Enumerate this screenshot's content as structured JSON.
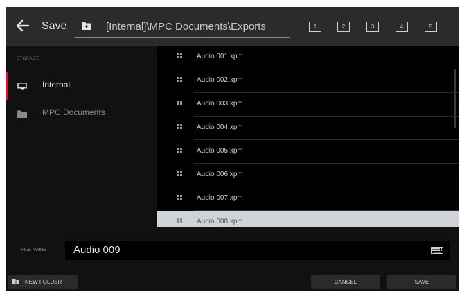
{
  "header": {
    "back_icon": "arrow-left-icon",
    "title": "Save",
    "folder_up_icon": "folder-up-icon",
    "path": "[Internal]\\MPC Documents\\Exports",
    "quick_slots": [
      "1",
      "2",
      "3",
      "4",
      "5"
    ]
  },
  "sidebar": {
    "section_label": "STORAGE",
    "items": [
      {
        "label": "Internal",
        "icon": "monitor-icon",
        "active": true
      },
      {
        "label": "MPC Documents",
        "icon": "folder-icon",
        "active": false
      }
    ]
  },
  "files": [
    {
      "name": "Audio 001.xpm",
      "icon": "grid-icon"
    },
    {
      "name": "Audio 002.xpm",
      "icon": "grid-icon"
    },
    {
      "name": "Audio 003.xpm",
      "icon": "grid-icon"
    },
    {
      "name": "Audio 004.xpm",
      "icon": "grid-icon"
    },
    {
      "name": "Audio 005.xpm",
      "icon": "grid-icon"
    },
    {
      "name": "Audio 006.xpm",
      "icon": "grid-icon"
    },
    {
      "name": "Audio 007.xpm",
      "icon": "grid-icon"
    },
    {
      "name": "Audio 008.xpm",
      "icon": "grid-icon",
      "selected": true
    }
  ],
  "file_name": {
    "label": "FILE NAME",
    "value": "Audio 009",
    "keyboard_icon": "keyboard-icon"
  },
  "footer": {
    "new_folder": "NEW FOLDER",
    "cancel": "CANCEL",
    "save": "SAVE"
  },
  "colors": {
    "accent": "#d8103a",
    "selected_row": "#d0d4d8",
    "header_bg": "#2b2b2b"
  }
}
